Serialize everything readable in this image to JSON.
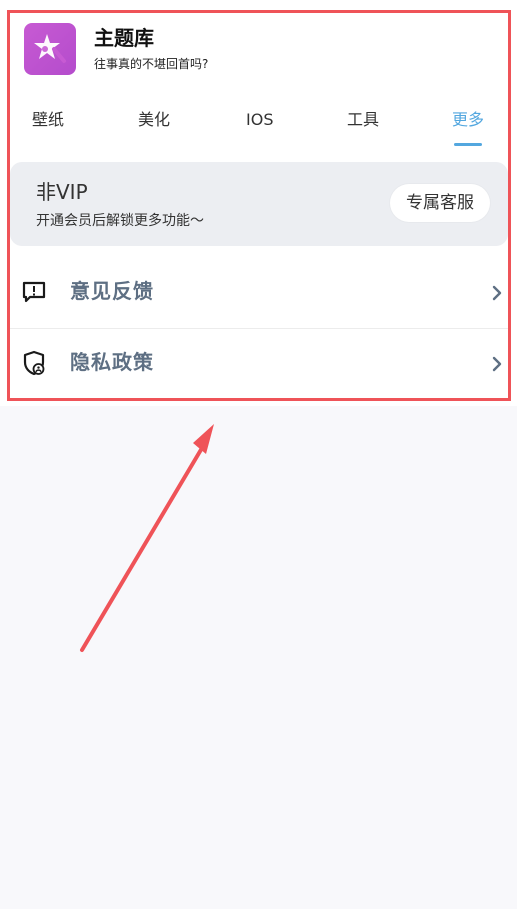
{
  "header": {
    "title": "主题库",
    "subtitle": "往事真的不堪回首吗?"
  },
  "tabs": [
    {
      "label": "壁纸",
      "icon": "",
      "active": false
    },
    {
      "label": "美化",
      "icon": "",
      "active": false
    },
    {
      "label": "IOS",
      "icon": "",
      "active": false
    },
    {
      "label": "工具",
      "icon": "",
      "active": false
    },
    {
      "label": "更多",
      "icon": "",
      "active": true
    }
  ],
  "vip": {
    "title": "非VIP",
    "subtitle": "开通会员后解锁更多功能〜",
    "service_button": "专属客服"
  },
  "list": [
    {
      "label": "意见反馈",
      "icon": "feedback-icon"
    },
    {
      "label": "隐私政策",
      "icon": "privacy-icon"
    }
  ],
  "colors": {
    "accent": "#53a7df",
    "highlight": "#ef5358",
    "app_icon": "#c75ad3",
    "list_text": "#5e6f83"
  }
}
